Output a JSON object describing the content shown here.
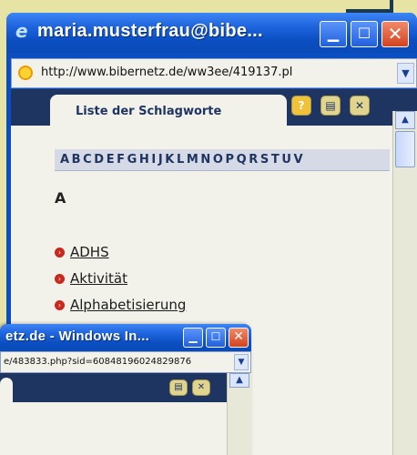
{
  "window1": {
    "title": "maria.musterfrau@bibe...",
    "url": "http://www.bibernetz.de/ww3ee/419137.pl",
    "tab_label": "Liste der Schlagworte",
    "alphabet": "ABCDEFGHIJKLMNOPQRSTUV",
    "section_letter": "A",
    "keywords": [
      "ADHS",
      "Aktivität",
      "Alphabetisierung"
    ],
    "buttons": {
      "help": "?",
      "print": "▤",
      "close": "✕"
    }
  },
  "window2": {
    "title": "etz.de - Windows In...",
    "url": "e/483833.php?sid=60848196024829876"
  },
  "icons": [
    "internet-explorer-icon",
    "minimize-icon",
    "maximize-icon",
    "close-icon",
    "page-icon",
    "dropdown-arrow-icon",
    "help-icon",
    "print-icon",
    "close-page-icon",
    "bullet-icon",
    "scroll-up-icon"
  ],
  "colors": {
    "titlebar": "#0a4ec1",
    "toolbar": "#1f3561",
    "page_background": "#f2f2ea",
    "bullet": "#c8281e",
    "backdrop": "#e6e3a5"
  }
}
